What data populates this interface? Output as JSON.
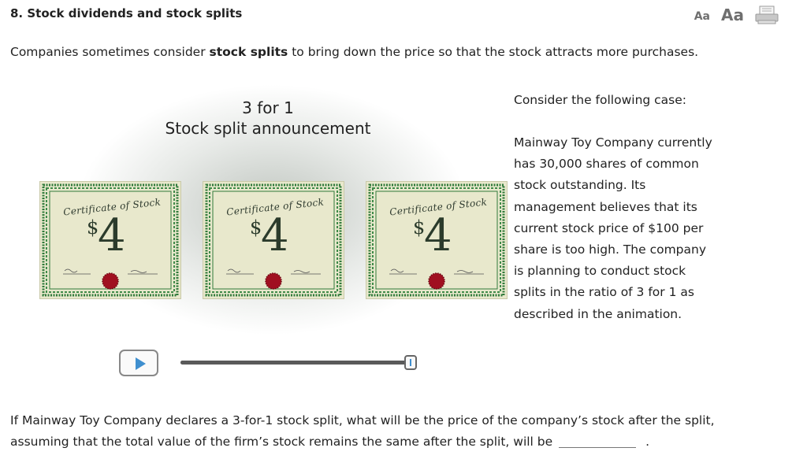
{
  "header": {
    "title": "8. Stock dividends and stock splits",
    "font_small_label": "Aa",
    "font_large_label": "Aa",
    "print_icon": "print-icon"
  },
  "intro": {
    "before": "Companies sometimes consider ",
    "bold": "stock splits",
    "after": " to bring down the price so that the stock attracts more purchases."
  },
  "animation": {
    "title_line1": "3 for 1",
    "title_line2": "Stock split announcement",
    "certificates": [
      {
        "heading": "Certificate of Stock",
        "dollar": "$",
        "value": "4"
      },
      {
        "heading": "Certificate of Stock",
        "dollar": "$",
        "value": "4"
      },
      {
        "heading": "Certificate of Stock",
        "dollar": "$",
        "value": "4"
      }
    ],
    "play_icon": "play-icon",
    "progress": 1.0
  },
  "case": {
    "lead": "Consider the following case:",
    "lines": [
      "Mainway Toy Company currently",
      "has 30,000 shares of common",
      "stock outstanding. Its",
      "management believes that its",
      "current stock price of $100 per",
      "share is too high. The company",
      "is planning to conduct stock",
      "splits in the ratio of 3 for 1 as",
      "described in the animation."
    ]
  },
  "question": {
    "line1": "If Mainway Toy Company declares a 3-for-1 stock split, what will be the price of the company’s stock after the split,",
    "line2": "assuming that the total value of the firm’s stock remains the same after the split, will be",
    "end": "."
  },
  "colors": {
    "certificate_bg": "#e6e6c8",
    "certificate_border": "#2f7a3a",
    "seal": "#a01020",
    "play_accent": "#3f8fcf",
    "progress": "#5a5a5a"
  }
}
